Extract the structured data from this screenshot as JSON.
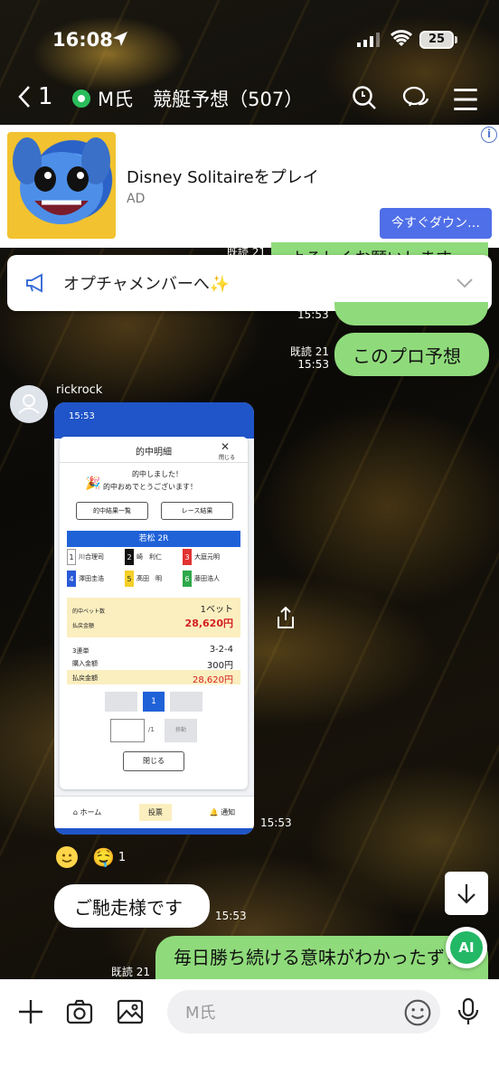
{
  "status_bar": {
    "time": "16:08",
    "battery": "25"
  },
  "header": {
    "back_count": "1",
    "group_name": "M氏",
    "title": "競艇予想（507）"
  },
  "ad": {
    "title": "Disney Solitaireをプレイ",
    "label": "AD",
    "cta": "今すぐダウン…",
    "info": "i"
  },
  "notice": {
    "text": "オプチャメンバーへ✨"
  },
  "messages": [
    {
      "type": "sent",
      "partial": "よろしくお願いします",
      "meta_time": "15:53"
    },
    {
      "type": "sent",
      "text": "このプロ予想",
      "read": "既読 21",
      "time": "15:53"
    },
    {
      "type": "received_image",
      "sender": "rickrock",
      "time": "15:53"
    },
    {
      "type": "received",
      "text": "ご馳走様です",
      "time": "15:53"
    },
    {
      "type": "sent",
      "text": "毎日勝ち続ける意味がわかったず！",
      "read": "既読 21"
    }
  ],
  "top_read": "既読 21",
  "reactions": {
    "count": "1"
  },
  "screenshot": {
    "time": "15:53",
    "title": "的中明細",
    "close_label": "閉じる",
    "hit_line1": "的中しました！",
    "hit_line2": "的中おめでとうございます！",
    "btn_list": "的中結果一覧",
    "btn_race": "レース結果",
    "race": "若松 2R",
    "racers": [
      {
        "num": "1",
        "name": "川合理司",
        "color": "#ffffff"
      },
      {
        "num": "2",
        "name": "崎　利仁",
        "color": "#111111"
      },
      {
        "num": "3",
        "name": "大庭元明",
        "color": "#e23232"
      },
      {
        "num": "4",
        "name": "澤田圭浩",
        "color": "#2a5ad8"
      },
      {
        "num": "5",
        "name": "髙田　明",
        "color": "#f5d028"
      },
      {
        "num": "6",
        "name": "藤田浩人",
        "color": "#2ea84a"
      }
    ],
    "hit_bet_label": "的中ベット数",
    "hit_bet_value": "1ベット",
    "payout_label": "払戻金額",
    "payout_value": "28,620円",
    "bet_type": "3連単",
    "combo": "3-2-4",
    "buy_label": "購入金額",
    "buy_value": "300円",
    "payout_label2": "払戻金額",
    "payout_value2": "28,620円",
    "page": "1",
    "page_total": "/1",
    "jump": "移動",
    "close_btn": "閉じる",
    "nav": [
      "ホーム",
      "投票",
      "通知"
    ]
  },
  "input": {
    "placeholder": "M氏"
  }
}
